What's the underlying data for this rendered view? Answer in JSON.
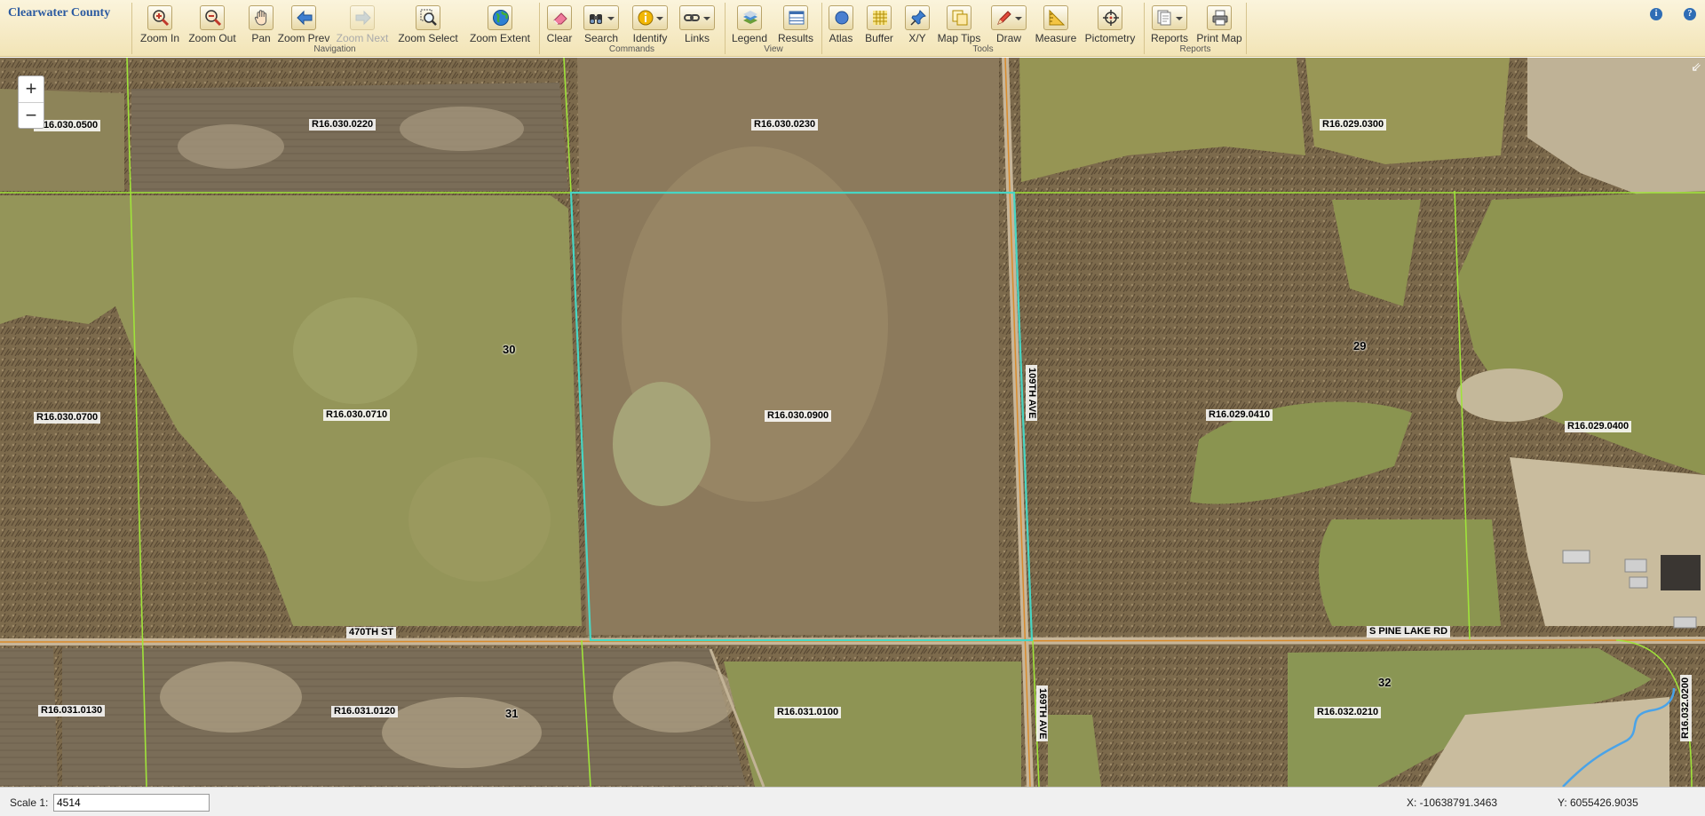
{
  "app": {
    "title": "Clearwater County"
  },
  "toolbar": {
    "groups": [
      {
        "label": "Navigation",
        "tools": [
          "Zoom In",
          "Zoom Out",
          "Pan",
          "Zoom Prev",
          "Zoom Next",
          "Zoom Select",
          "Zoom Extent"
        ]
      },
      {
        "label": "Commands",
        "tools": [
          "Clear",
          "Search",
          "Identify",
          "Links"
        ]
      },
      {
        "label": "View",
        "tools": [
          "Legend",
          "Results"
        ]
      },
      {
        "label": "Tools",
        "tools": [
          "Atlas",
          "Buffer",
          "X/Y",
          "Map Tips",
          "Draw",
          "Measure",
          "Pictometry"
        ]
      },
      {
        "label": "Reports",
        "tools": [
          "Reports",
          "Print Map"
        ]
      }
    ],
    "disabled_tools": [
      "Zoom Next"
    ],
    "icons": {
      "Zoom In": "zoom-in-icon",
      "Zoom Out": "zoom-out-icon",
      "Pan": "hand-icon",
      "Zoom Prev": "arrow-left-icon",
      "Zoom Next": "arrow-right-icon",
      "Zoom Select": "magnifier-select-icon",
      "Zoom Extent": "globe-icon",
      "Clear": "eraser-icon",
      "Search": "binoculars-icon",
      "Identify": "info-icon",
      "Links": "chain-link-icon",
      "Legend": "layers-icon",
      "Results": "table-icon",
      "Atlas": "atlas-icon",
      "Buffer": "buffer-grid-icon",
      "X/Y": "pushpin-icon",
      "Map Tips": "tooltip-icon",
      "Draw": "pencil-icon",
      "Measure": "ruler-icon",
      "Pictometry": "crosshair-icon",
      "Reports": "reports-icon",
      "Print Map": "printer-icon"
    },
    "help_icon": "help-icon",
    "info_icon": "info-icon"
  },
  "map": {
    "zoom_in_label": "+",
    "zoom_out_label": "−",
    "parcels": [
      "R16.030.0500",
      "R16.030.0220",
      "R16.030.0230",
      "R16.029.0300",
      "R16.030.0700",
      "R16.030.0710",
      "R16.030.0900",
      "R16.029.0410",
      "R16.029.0400",
      "R16.031.0130",
      "R16.031.0120",
      "R16.031.0100",
      "R16.032.0210",
      "R16.032.0200"
    ],
    "sections": [
      "30",
      "29",
      "31",
      "32"
    ],
    "roads": [
      "470TH ST",
      "109TH AVE",
      "S PINE LAKE RD",
      "169TH AVE"
    ],
    "colors": {
      "parcel_line": "#9fe33a",
      "selection_outline": "#47d6c4",
      "road": "#d98b2b",
      "stream": "#4aa3e8"
    }
  },
  "statusbar": {
    "scale_label": "Scale 1:",
    "scale_value": "4514",
    "x_label": "X: -10638791.3463",
    "y_label": "Y: 6055426.9035"
  }
}
